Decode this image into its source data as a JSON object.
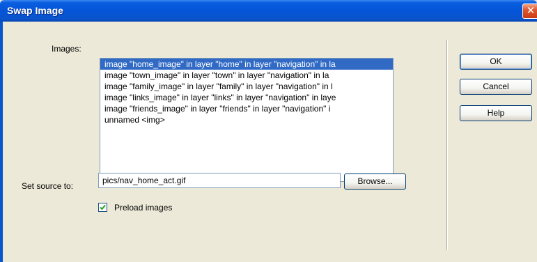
{
  "dialog": {
    "title": "Swap Image",
    "close_glyph": "✕"
  },
  "images": {
    "label": "Images:",
    "items": [
      "image \"home_image\" in layer \"home\" in layer \"navigation\" in la",
      "image \"town_image\" in layer \"town\" in layer \"navigation\" in la",
      "image \"family_image\" in layer \"family\" in layer \"navigation\" in l",
      "image \"links_image\" in layer \"links\" in layer \"navigation\" in laye",
      "image \"friends_image\" in layer \"friends\" in layer \"navigation\" i",
      "unnamed <img>"
    ],
    "selected_index": 0
  },
  "source": {
    "label": "Set source to:",
    "value": "pics/nav_home_act.gif",
    "browse_label": "Browse..."
  },
  "preload": {
    "label": "Preload images",
    "checked": true
  },
  "buttons": {
    "ok": "OK",
    "cancel": "Cancel",
    "help": "Help"
  },
  "colors": {
    "titlebar": "#0554d8",
    "selection": "#316ac5",
    "close": "#e0582e"
  },
  "icons": [
    "close-icon",
    "check-icon"
  ]
}
